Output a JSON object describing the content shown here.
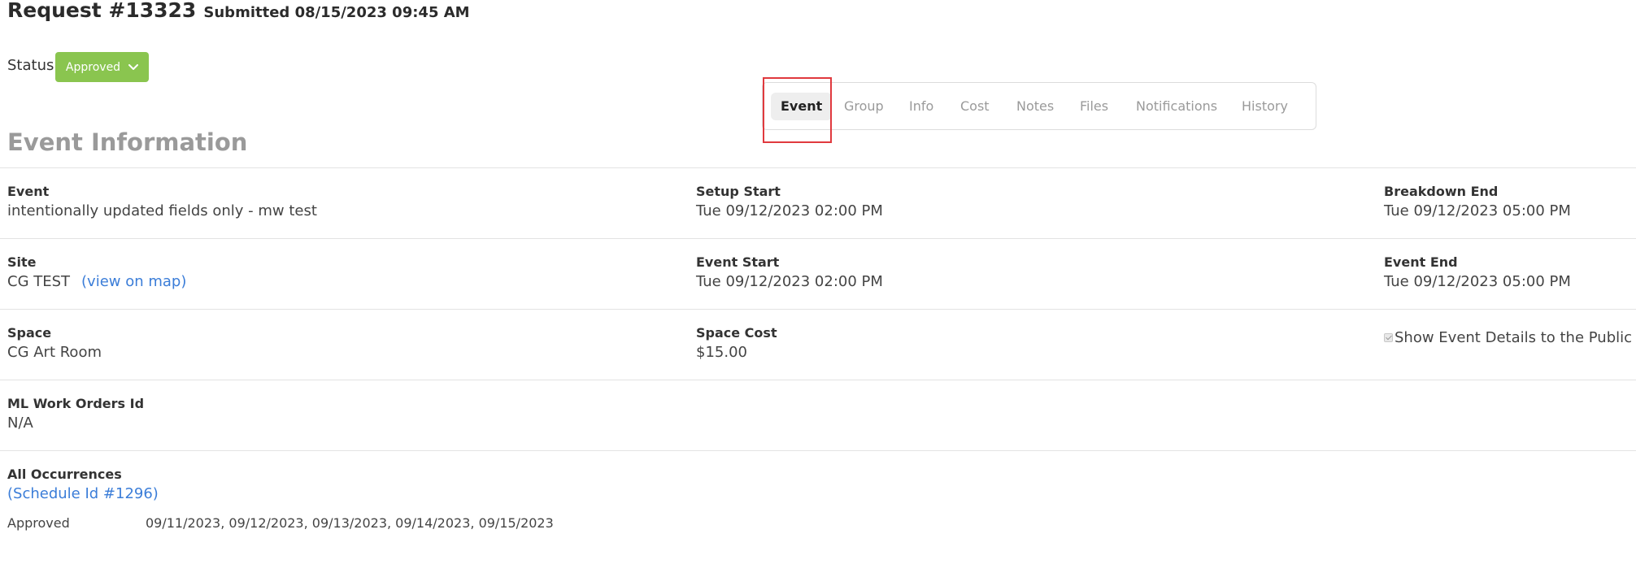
{
  "header": {
    "title": "Request #13323",
    "submitted": "Submitted 08/15/2023 09:45 AM"
  },
  "status": {
    "label": "Status",
    "value": "Approved",
    "color": "#8ac54f"
  },
  "tabs": [
    {
      "label": "Event",
      "active": true
    },
    {
      "label": "Group",
      "active": false
    },
    {
      "label": "Info",
      "active": false
    },
    {
      "label": "Cost",
      "active": false
    },
    {
      "label": "Notes",
      "active": false
    },
    {
      "label": "Files",
      "active": false
    },
    {
      "label": "Notifications",
      "active": false
    },
    {
      "label": "History",
      "active": false
    }
  ],
  "section": {
    "title": "Event Information"
  },
  "fields": {
    "event": {
      "label": "Event",
      "value": "intentionally updated fields only - mw test"
    },
    "setup_start": {
      "label": "Setup Start",
      "value": "Tue 09/12/2023 02:00 PM"
    },
    "breakdown_end": {
      "label": "Breakdown End",
      "value": "Tue 09/12/2023 05:00 PM"
    },
    "site": {
      "label": "Site",
      "value": "CG TEST",
      "link": "(view on map)"
    },
    "event_start": {
      "label": "Event Start",
      "value": "Tue 09/12/2023 02:00 PM"
    },
    "event_end": {
      "label": "Event End",
      "value": "Tue 09/12/2023 05:00 PM"
    },
    "space": {
      "label": "Space",
      "value": "CG Art Room"
    },
    "space_cost": {
      "label": "Space Cost",
      "value": "$15.00"
    },
    "show_public": {
      "label": "Show Event Details to the Public",
      "checked": true
    },
    "ml_work_orders": {
      "label": "ML Work Orders Id",
      "value": "N/A"
    },
    "all_occurrences": {
      "label": "All Occurrences",
      "link": "(Schedule Id #1296)",
      "status": "Approved",
      "dates": "09/11/2023, 09/12/2023, 09/13/2023, 09/14/2023, 09/15/2023"
    }
  },
  "colors": {
    "link": "#3b7dd8",
    "highlight": "#e0393e",
    "muted": "#9a9a9a"
  },
  "icons": {
    "status_dropdown": "chevron-down-icon",
    "public_checkbox": "check-icon"
  }
}
